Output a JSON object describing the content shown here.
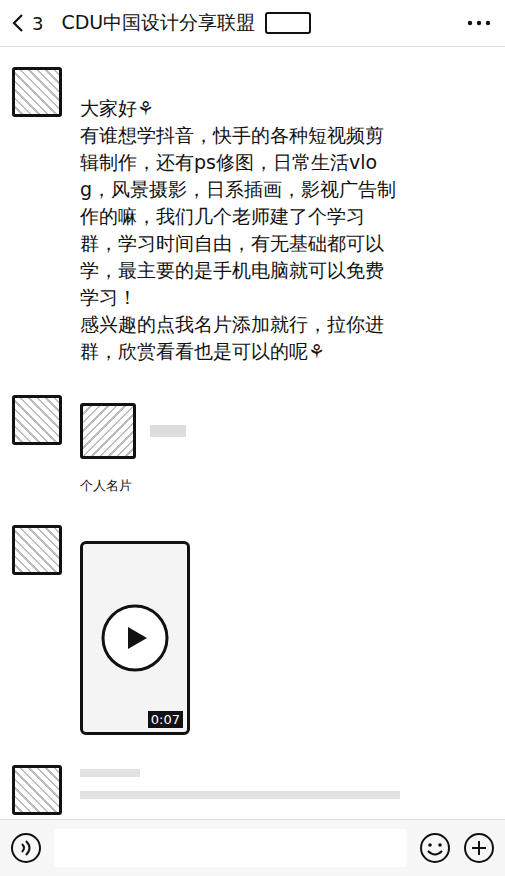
{
  "header": {
    "unread_count": "3",
    "title": "CDU中国设计分享联盟"
  },
  "messages": [
    {
      "kind": "text",
      "paragraphs": [
        "大家好⚘",
        "有谁想学抖音，快手的各种短视频剪辑制作，还有ps修图，日常生活vlog，风景摄影，日系插画，影视广告制作的嘛，我们几个老师建了个学习群，学习时间自由，有无基础都可以学，最主要的是手机电脑就可以免费学习！",
        "感兴趣的点我名片添加就行，拉你进群，欣赏看看也是可以的呢⚘"
      ]
    },
    {
      "kind": "card",
      "label": "个人名片"
    },
    {
      "kind": "video",
      "duration": "0:07"
    },
    {
      "kind": "redacted"
    }
  ]
}
